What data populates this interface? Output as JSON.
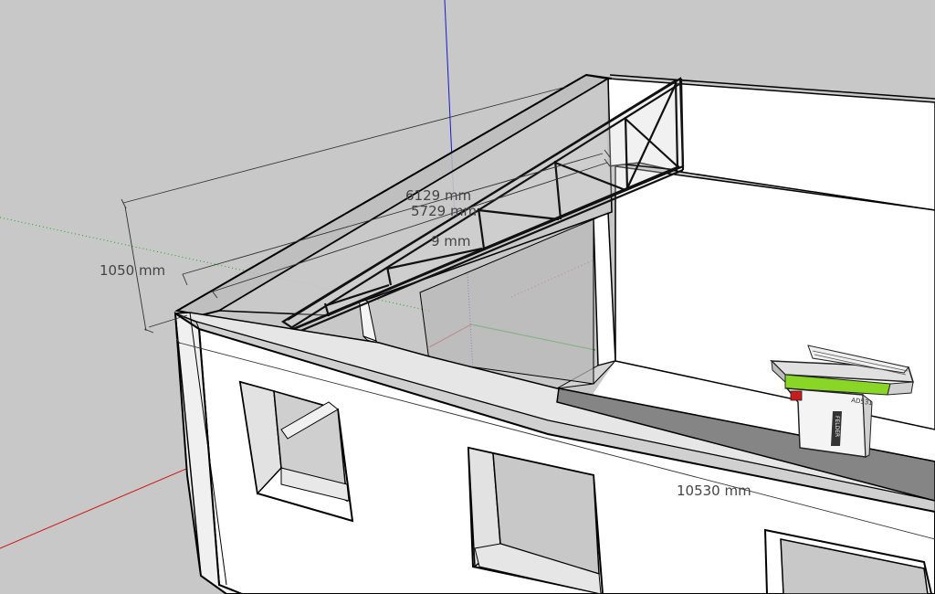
{
  "viewport": {
    "background": "#c8c8c8",
    "axis_colors": {
      "red": "#d01818",
      "green": "#18a818",
      "blue": "#1818d0"
    }
  },
  "dimensions": {
    "truss_outer_length": "6129 mm",
    "truss_inner_length": "5729 mm",
    "truss_partial_length": "9 mm",
    "truss_height": "1050 mm",
    "wall_length": "10530 mm"
  },
  "machine": {
    "accent_color": "#8ad626",
    "brand_text": "FELDER",
    "model_text": "AD531"
  }
}
